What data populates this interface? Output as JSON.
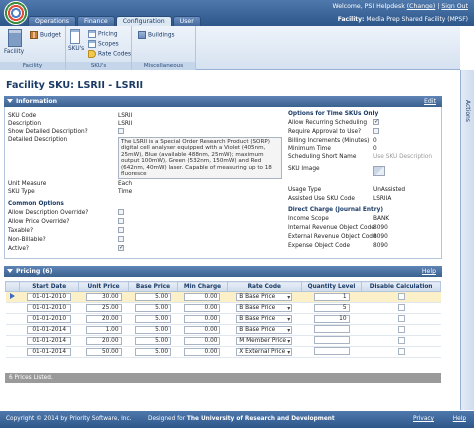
{
  "header": {
    "welcome": "Welcome, PSI Helpdesk",
    "change": "(Change)",
    "signout": "Sign Out",
    "facility_label": "Facility:",
    "facility_value": "Media Prep Shared Facility (MPSF)",
    "separator": "|"
  },
  "tabs": [
    "Operations",
    "Finance",
    "Configuration",
    "User"
  ],
  "ribbon": {
    "facility_btn": "Facility",
    "budget_btn": "Budget",
    "skus_btn": "SKU's",
    "pricing_btn": "Pricing",
    "scopes_btn": "Scopes",
    "ratecodes_btn": "Rate Codes",
    "buildings_btn": "Buildings",
    "group_facility": "Facility",
    "group_skus": "SKU's",
    "group_misc": "Miscellaneous"
  },
  "actions_tab": "Actions",
  "page_title": "Facility SKU: LSRII - LSRII",
  "information": {
    "title": "Information",
    "edit": "Edit",
    "sku_code_label": "SKU Code",
    "sku_code": "LSRII",
    "description_label": "Description",
    "description": "LSRII",
    "show_detailed_label": "Show Detailed Description?",
    "detailed_label": "Detailed Description",
    "detailed": "The LSRII is a Special Order Research Product (SORP) digital cell analyser equipped with a Violet (405nm, 25mW), Blue (available 488nm, 25mW); maximum output 100mW), Green (532nm, 150mW) and Red (642nm, 40mW) laser. Capable of measuring up to 18 fluoresce",
    "unit_measure_label": "Unit Measure",
    "unit_measure": "Each",
    "sku_type_label": "SKU Type",
    "sku_type": "Time",
    "common_options": "Common Options",
    "allow_desc_override": "Allow Description Override?",
    "allow_price_override": "Allow Price Override?",
    "taxable": "Taxable?",
    "non_billable": "Non-Billable?",
    "active": "Active?",
    "time_opts": "Options for Time SKUs Only",
    "allow_recurring": "Allow Recurring Scheduling",
    "require_approval": "Require Approval to Use?",
    "billing_increments_label": "Billing Increments (Minutes)",
    "billing_increments": "0",
    "minimum_time_label": "Minimum Time",
    "minimum_time": "0",
    "scheduling_short_name_label": "Scheduling Short Name",
    "scheduling_short_name": "Use SKU Description",
    "sku_image_label": "SKU Image",
    "usage_type_label": "Usage Type",
    "usage_type": "UnAssisted",
    "assisted_sku_label": "Assisted Use SKU Code",
    "assisted_sku": "LSRIIA",
    "direct_charge": "Direct Charge (Journal Entry)",
    "income_scope_label": "Income Scope",
    "income_scope": "BANK",
    "internal_rev_label": "Internal Revenue Object Code",
    "internal_rev": "8090",
    "external_rev_label": "External Revenue Object Code",
    "external_rev": "8090",
    "expense_obj_label": "Expense Object Code",
    "expense_obj": "8090"
  },
  "pricing": {
    "title": "Pricing (6)",
    "help": "Help",
    "columns": [
      "Start Date",
      "Unit Price",
      "Base Price",
      "Min Charge",
      "Rate Code",
      "Quantity Level",
      "Disable Calculation"
    ],
    "rows": [
      {
        "date": "01-01-2010",
        "unit": "30.00",
        "base": "5.00",
        "min": "0.00",
        "rate": "B Base Price",
        "qty": "1"
      },
      {
        "date": "01-01-2010",
        "unit": "25.00",
        "base": "5.00",
        "min": "0.00",
        "rate": "B Base Price",
        "qty": "5"
      },
      {
        "date": "01-01-2010",
        "unit": "20.00",
        "base": "5.00",
        "min": "0.00",
        "rate": "B Base Price",
        "qty": "10"
      },
      {
        "date": "01-01-2014",
        "unit": "1.00",
        "base": "5.00",
        "min": "0.00",
        "rate": "B Base Price",
        "qty": ""
      },
      {
        "date": "01-01-2014",
        "unit": "20.00",
        "base": "5.00",
        "min": "0.00",
        "rate": "M Member Price",
        "qty": ""
      },
      {
        "date": "01-01-2014",
        "unit": "50.00",
        "base": "5.00",
        "min": "0.00",
        "rate": "X External Price",
        "qty": ""
      }
    ],
    "listed": "6 Prices Listed."
  },
  "footer": {
    "copyright": "Copyright © 2014 by Priority Software, Inc.",
    "designed": "Designed for",
    "university": "The University of Research and Development",
    "privacy": "Privacy",
    "help": "Help"
  }
}
